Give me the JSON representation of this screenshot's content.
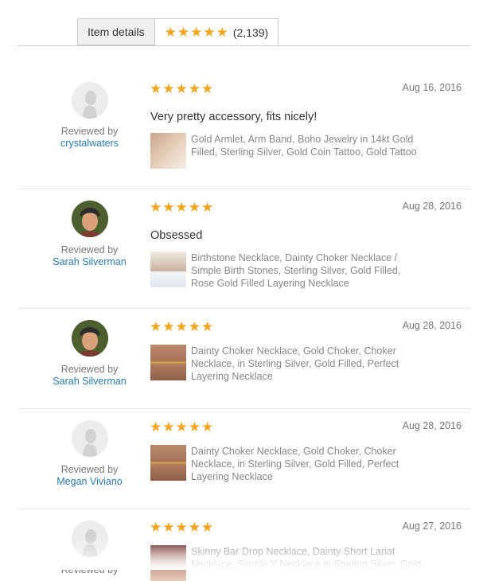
{
  "tabs": {
    "item_details": "Item details",
    "reviews_count": "(2,139)",
    "reviews_stars": 5
  },
  "colors": {
    "star": "#f5a41e",
    "link": "#2a7bb0"
  },
  "reviews": [
    {
      "rating": 5,
      "date": "Aug 16, 2016",
      "reviewed_by": "Reviewed by",
      "name": "crystalwaters",
      "avatar": "default-avatar-icon",
      "title": "Very pretty accessory, fits nicely!",
      "item": "Gold Armlet, Arm Band, Boho Jewelry in 14kt Gold Filled, Sterling Silver, Gold Coin Tattoo, Gold Tattoo"
    },
    {
      "rating": 5,
      "date": "Aug 28, 2016",
      "reviewed_by": "Reviewed by",
      "name": "Sarah Silverman",
      "avatar": "profile-photo",
      "title": "Obsessed",
      "item": "Birthstone Necklace, Dainty Choker Necklace / Simple Birth Stones, Sterling Silver, Gold Filled, Rose Gold Filled Layering Necklace"
    },
    {
      "rating": 5,
      "date": "Aug 28, 2016",
      "reviewed_by": "Reviewed by",
      "name": "Sarah Silverman",
      "avatar": "profile-photo",
      "title": "",
      "item": "Dainty Choker Necklace, Gold Choker, Choker Necklace, in Sterling Silver, Gold Filled, Perfect Layering Necklace"
    },
    {
      "rating": 5,
      "date": "Aug 28, 2016",
      "reviewed_by": "Reviewed by",
      "name": "Megan Viviano",
      "avatar": "default-avatar-icon",
      "title": "",
      "item": "Dainty Choker Necklace, Gold Choker, Choker Necklace, in Sterling Silver, Gold Filled, Perfect Layering Necklace"
    },
    {
      "rating": 5,
      "date": "Aug 27, 2016",
      "reviewed_by": "Reviewed by",
      "name": "",
      "avatar": "default-avatar-icon",
      "title": "",
      "item": "Skinny Bar Drop Necklace, Dainty Short Lariat Necklace, Simple Y Necklace in Sterling Silver, Gold"
    }
  ]
}
